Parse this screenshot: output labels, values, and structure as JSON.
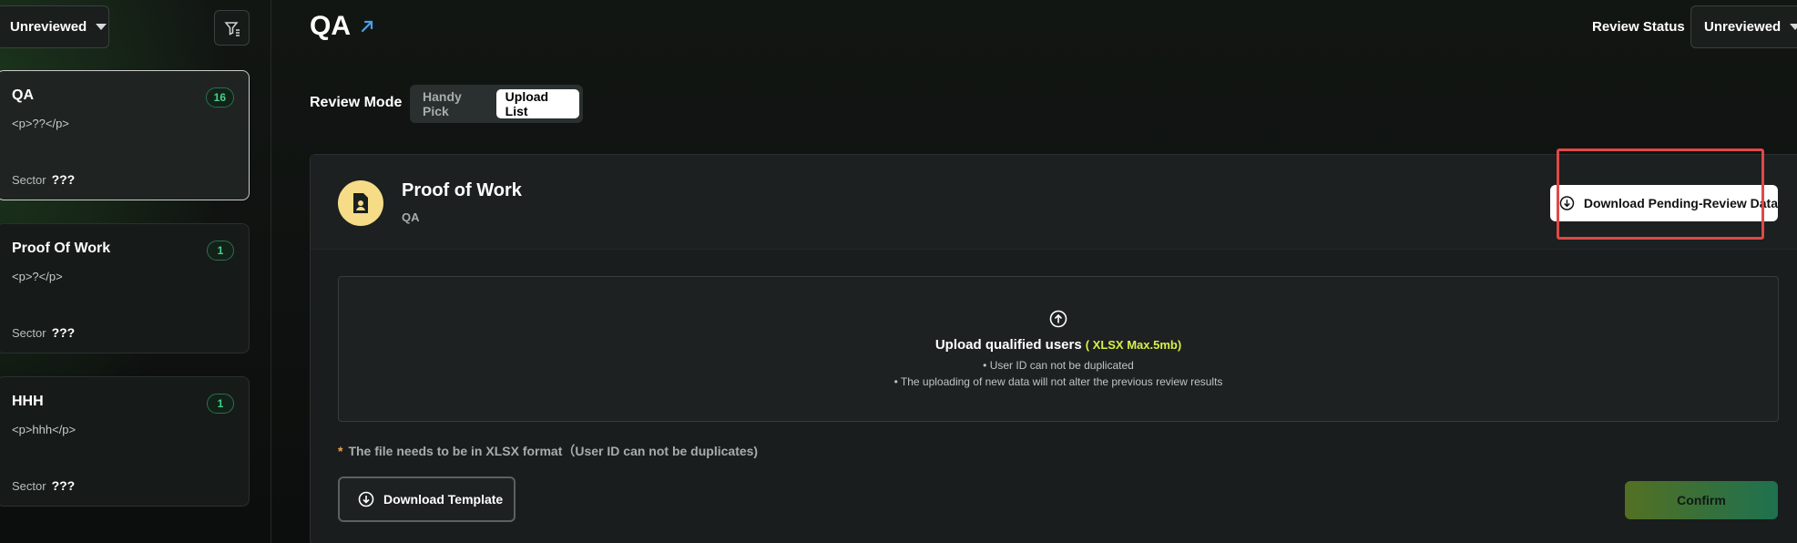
{
  "sidebar": {
    "status_filter": "Unreviewed",
    "cards": [
      {
        "title": "QA",
        "count": "16",
        "desc": "<p>??</p>",
        "sector_label": "Sector",
        "sector_value": "???"
      },
      {
        "title": "Proof Of Work",
        "count": "1",
        "desc": "<p>?</p>",
        "sector_label": "Sector",
        "sector_value": "???"
      },
      {
        "title": "HHH",
        "count": "1",
        "desc": "<p>hhh</p>",
        "sector_label": "Sector",
        "sector_value": "???"
      }
    ]
  },
  "header": {
    "title": "QA",
    "review_status_label": "Review Status",
    "review_status_value": "Unreviewed"
  },
  "review_mode": {
    "label": "Review Mode",
    "options": [
      "Handy Pick",
      "Upload List"
    ],
    "selected": "Upload List"
  },
  "panel": {
    "title": "Proof of Work",
    "subtitle": "QA",
    "download_pending_label": "Download Pending-Review Data",
    "upload": {
      "title": "Upload qualified users",
      "hint": "( XLSX Max.5mb)",
      "rules": [
        "• User ID can not be duplicated",
        "• The uploading of new data will not alter the previous review results"
      ]
    },
    "note": "The file needs to be in XLSX format（User ID can not be duplicates)",
    "download_template_label": "Download Template",
    "confirm_label": "Confirm"
  },
  "colors": {
    "accent_green": "#46d28a",
    "hint_yellow": "#d7f04a",
    "highlight_red": "#e14848",
    "doc_icon_bg": "#f6dc87"
  }
}
